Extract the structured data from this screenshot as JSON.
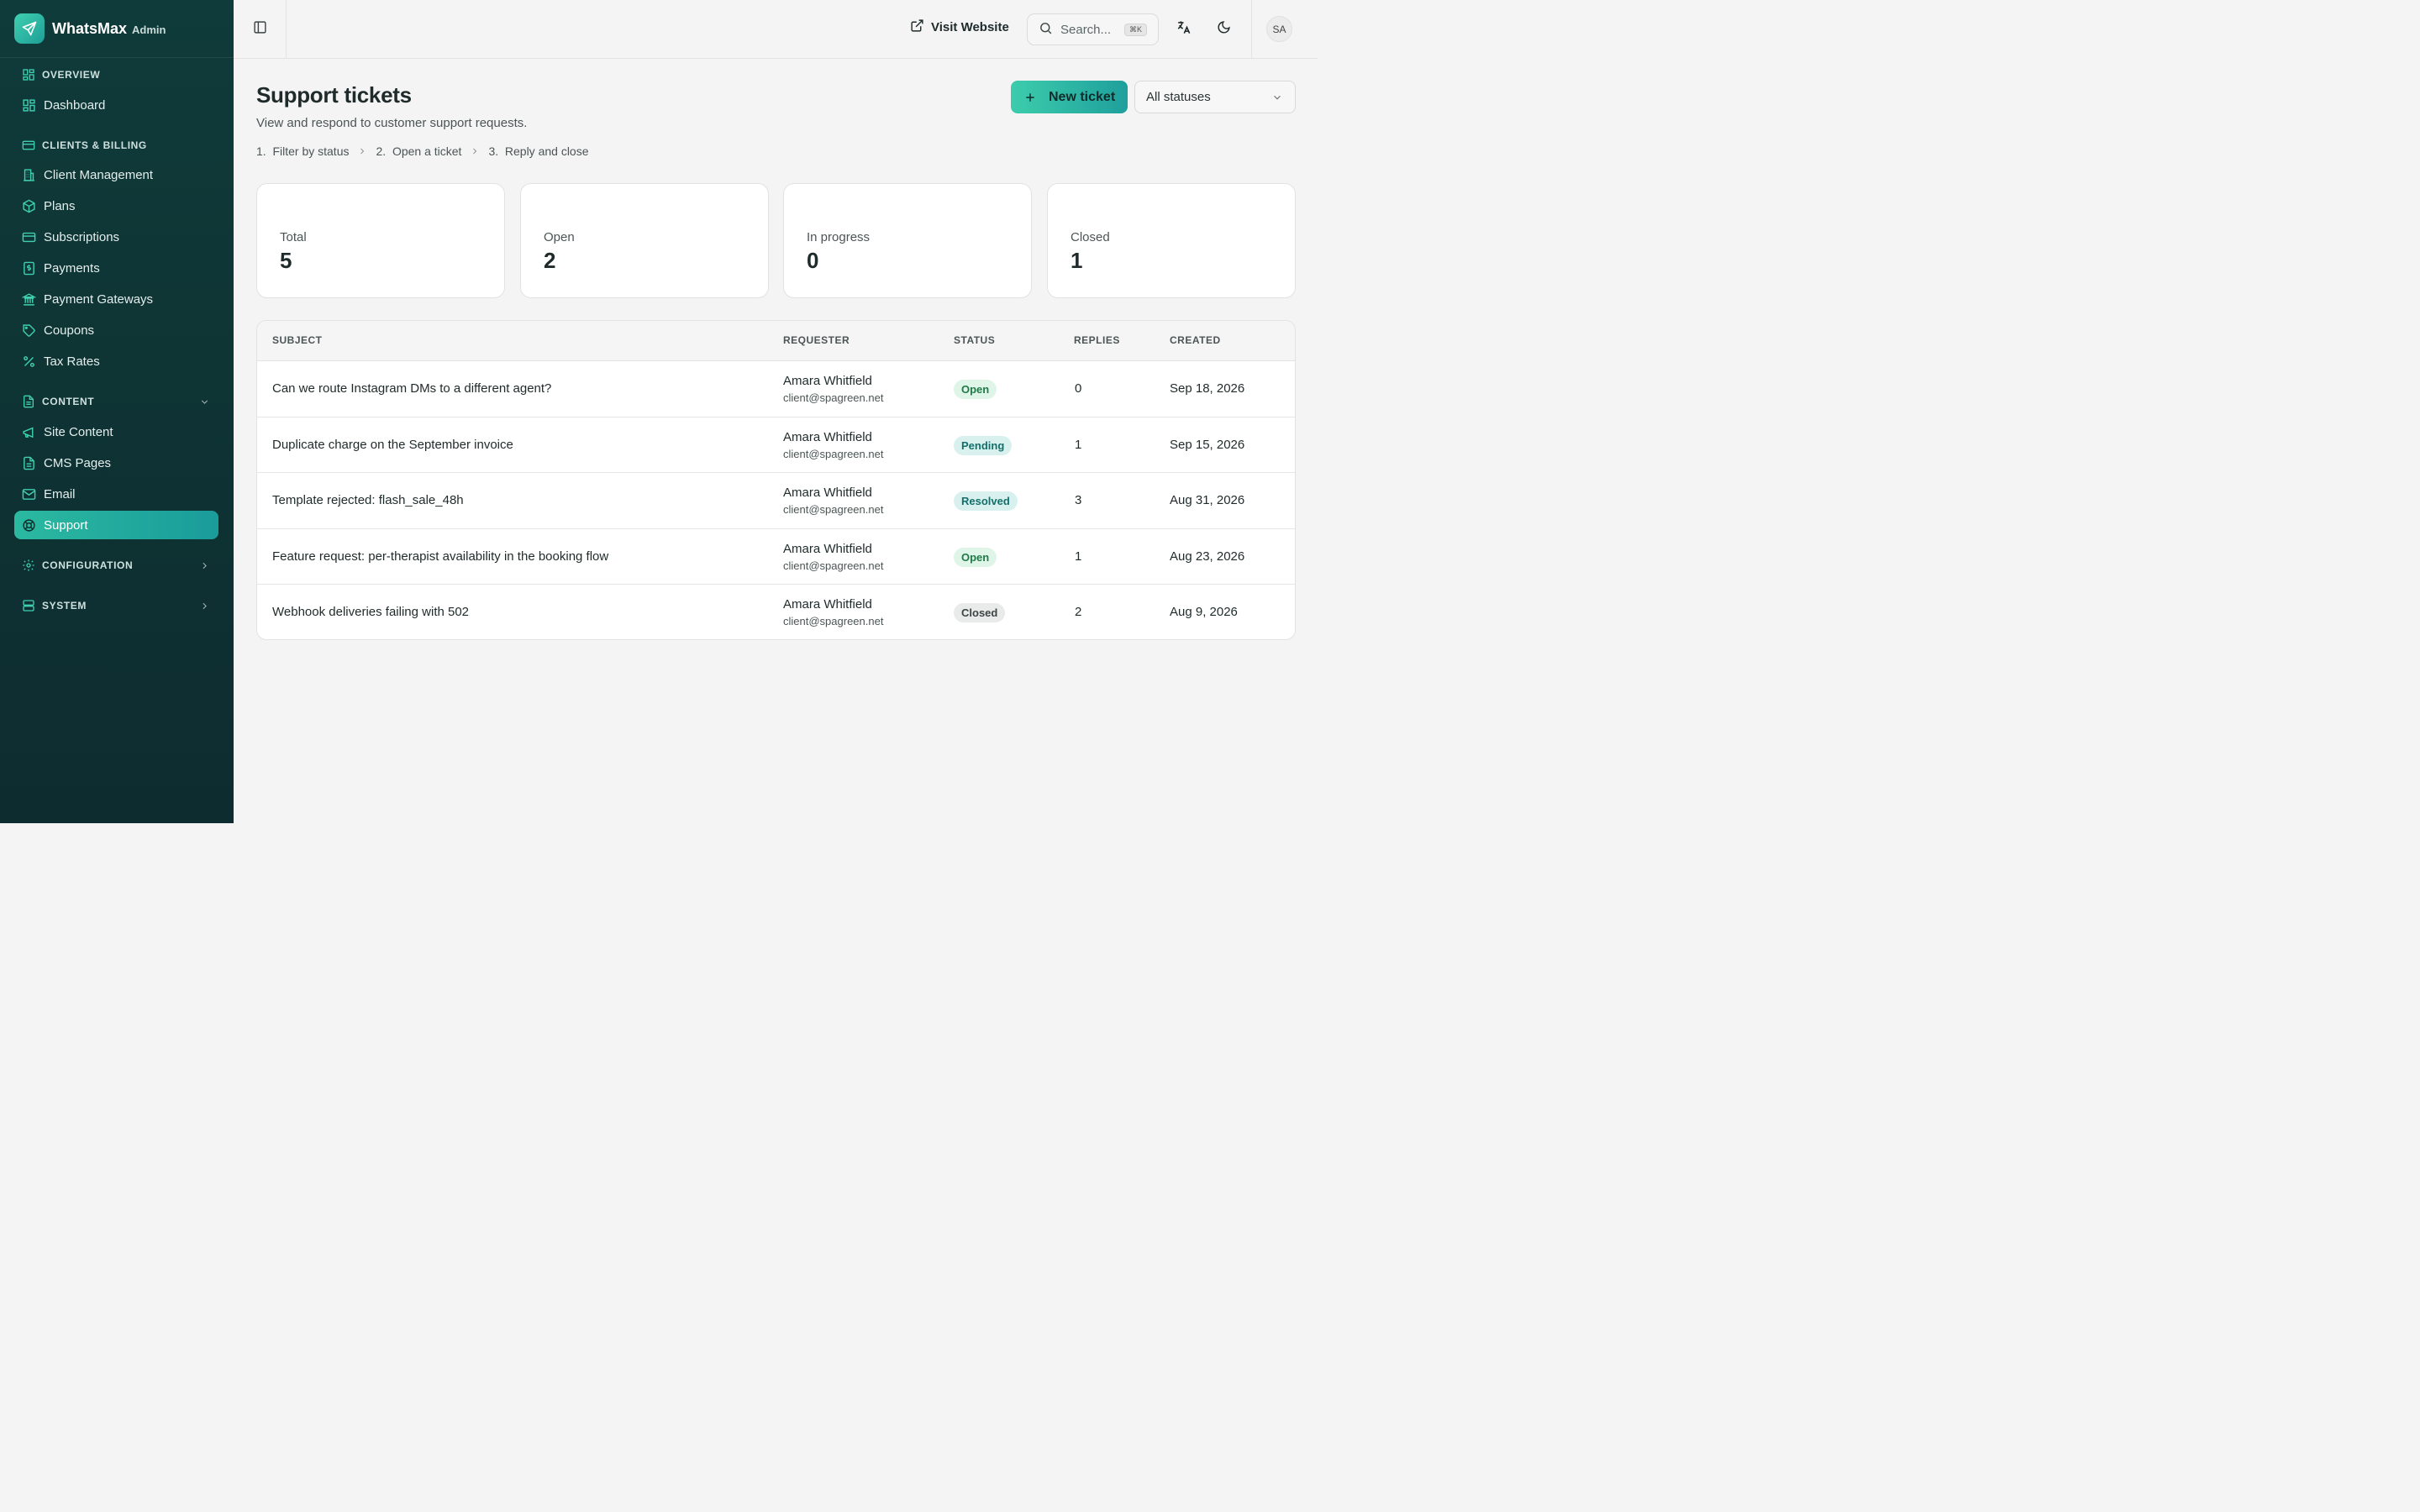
{
  "brand": {
    "name": "WhatsMax",
    "sub": "Admin"
  },
  "sidebar": {
    "sections": [
      {
        "label": "OVERVIEW"
      },
      {
        "label": "CLIENTS & BILLING"
      },
      {
        "label": "CONTENT"
      },
      {
        "label": "CONFIGURATION"
      },
      {
        "label": "SYSTEM"
      }
    ],
    "items": [
      {
        "label": "Dashboard"
      },
      {
        "label": "Client Management"
      },
      {
        "label": "Plans"
      },
      {
        "label": "Subscriptions"
      },
      {
        "label": "Payments"
      },
      {
        "label": "Payment Gateways"
      },
      {
        "label": "Coupons"
      },
      {
        "label": "Tax Rates"
      },
      {
        "label": "Site Content"
      },
      {
        "label": "CMS Pages"
      },
      {
        "label": "Email"
      },
      {
        "label": "Support"
      }
    ]
  },
  "topbar": {
    "visit_label": "Visit Website",
    "search_placeholder": "Search...",
    "search_shortcut": "⌘K",
    "avatar_initials": "SA"
  },
  "page": {
    "title": "Support tickets",
    "subtitle": "View and respond to customer support requests.",
    "steps": [
      "1.  Filter by status",
      "2.  Open a ticket",
      "3.  Reply and close"
    ],
    "new_button": "New ticket",
    "status_filter": "All statuses"
  },
  "stats": [
    {
      "label": "Total",
      "value": "5"
    },
    {
      "label": "Open",
      "value": "2"
    },
    {
      "label": "In progress",
      "value": "0"
    },
    {
      "label": "Closed",
      "value": "1"
    }
  ],
  "table": {
    "columns": [
      "SUBJECT",
      "REQUESTER",
      "STATUS",
      "REPLIES",
      "CREATED"
    ],
    "rows": [
      {
        "subject": "Can we route Instagram DMs to a different agent?",
        "name": "Amara Whitfield",
        "email": "client@spagreen.net",
        "status": "Open",
        "replies": "0",
        "created": "Sep 18, 2026"
      },
      {
        "subject": "Duplicate charge on the September invoice",
        "name": "Amara Whitfield",
        "email": "client@spagreen.net",
        "status": "Pending",
        "replies": "1",
        "created": "Sep 15, 2026"
      },
      {
        "subject": "Template rejected: flash_sale_48h",
        "name": "Amara Whitfield",
        "email": "client@spagreen.net",
        "status": "Resolved",
        "replies": "3",
        "created": "Aug 31, 2026"
      },
      {
        "subject": "Feature request: per-therapist availability in the booking flow",
        "name": "Amara Whitfield",
        "email": "client@spagreen.net",
        "status": "Open",
        "replies": "1",
        "created": "Aug 23, 2026"
      },
      {
        "subject": "Webhook deliveries failing with 502",
        "name": "Amara Whitfield",
        "email": "client@spagreen.net",
        "status": "Closed",
        "replies": "2",
        "created": "Aug 9, 2026"
      }
    ]
  },
  "colors": {
    "sidebar_bg": "#0f3b3a",
    "accent": "#2bb9a0",
    "open_badge": "#dff5e8",
    "closed_badge": "#e9eaea"
  }
}
